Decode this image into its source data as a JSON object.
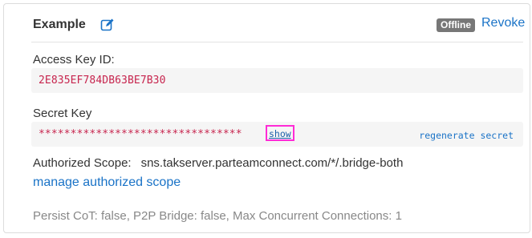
{
  "header": {
    "title": "Example",
    "edit_icon": "edit-icon",
    "status_badge": "Offline",
    "revoke_label": "Revoke"
  },
  "access_key": {
    "label": "Access Key ID:",
    "value": "2E835EF784DB63BE7B30"
  },
  "secret_key": {
    "label": "Secret Key",
    "masked_value": "********************************",
    "show_label": "show",
    "regenerate_label": "regenerate secret"
  },
  "scope": {
    "label": "Authorized Scope:",
    "value": "sns.takserver.parteamconnect.com/*/.bridge-both",
    "manage_label": "manage authorized scope"
  },
  "details": {
    "persist_text": "Persist CoT: false, P2P Bridge: false, Max Concurrent Connections: 1"
  },
  "colors": {
    "link": "#1a73c7",
    "code_text": "#c7254e",
    "badge_bg": "#777777",
    "highlight": "#ff2bd6"
  }
}
